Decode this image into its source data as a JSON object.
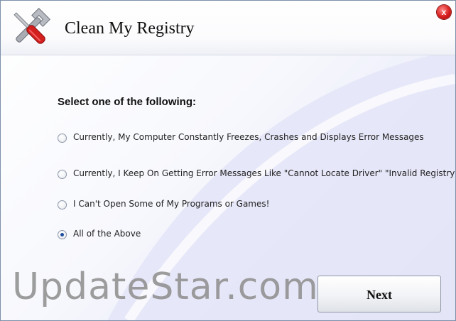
{
  "window": {
    "title": "Clean My Registry",
    "close_glyph": "x",
    "app_icon": "wrench-screwdriver-icon"
  },
  "main": {
    "prompt": "Select one of the following:",
    "options": [
      {
        "label": "Currently, My Computer Constantly Freezes, Crashes and Displays Error Messages",
        "selected": false
      },
      {
        "label": "Currently, I Keep On Getting Error Messages Like \"Cannot Locate Driver\" \"Invalid Registry",
        "selected": false
      },
      {
        "label": "I Can't Open Some of My Programs or Games!",
        "selected": false
      },
      {
        "label": "All of the Above",
        "selected": true
      }
    ],
    "next_label": "Next"
  },
  "watermark": "UpdateStar.com",
  "colors": {
    "accent": "#1f4f9c",
    "close": "#d81c1c",
    "background_tint": "#dcdff5"
  }
}
